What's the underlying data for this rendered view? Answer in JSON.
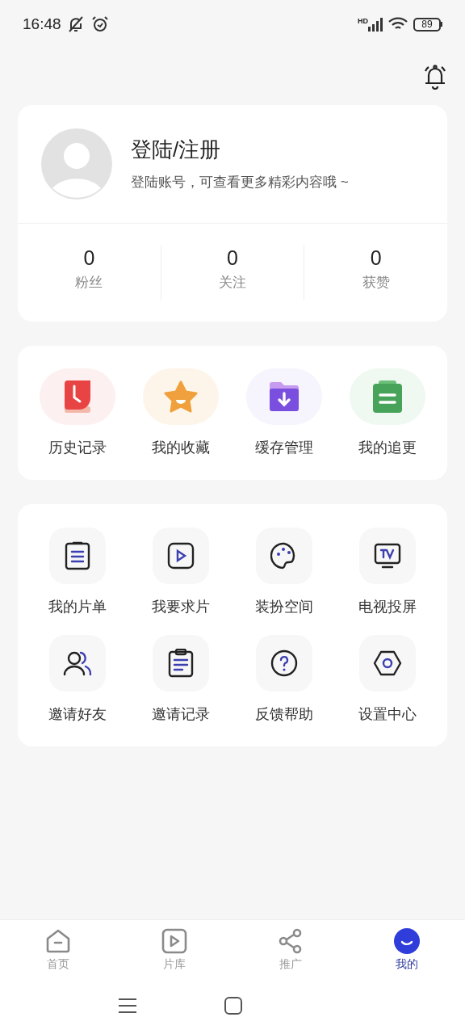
{
  "status_bar": {
    "time": "16:48",
    "network": "HD",
    "battery": "89"
  },
  "profile": {
    "title": "登陆/注册",
    "subtitle": "登陆账号，可查看更多精彩内容哦 ~",
    "stats": [
      {
        "value": "0",
        "label": "粉丝"
      },
      {
        "value": "0",
        "label": "关注"
      },
      {
        "value": "0",
        "label": "获赞"
      }
    ]
  },
  "quick_actions": [
    {
      "label": "历史记录",
      "color": "#fdf0f0"
    },
    {
      "label": "我的收藏",
      "color": "#fdf5ea"
    },
    {
      "label": "缓存管理",
      "color": "#f6f4fd"
    },
    {
      "label": "我的追更",
      "color": "#eff8f1"
    }
  ],
  "services": [
    {
      "label": "我的片单"
    },
    {
      "label": "我要求片"
    },
    {
      "label": "装扮空间"
    },
    {
      "label": "电视投屏"
    },
    {
      "label": "邀请好友"
    },
    {
      "label": "邀请记录"
    },
    {
      "label": "反馈帮助"
    },
    {
      "label": "设置中心"
    }
  ],
  "tab_bar": [
    {
      "label": "首页",
      "selected": false
    },
    {
      "label": "片库",
      "selected": false
    },
    {
      "label": "推广",
      "selected": false
    },
    {
      "label": "我的",
      "selected": true
    }
  ]
}
